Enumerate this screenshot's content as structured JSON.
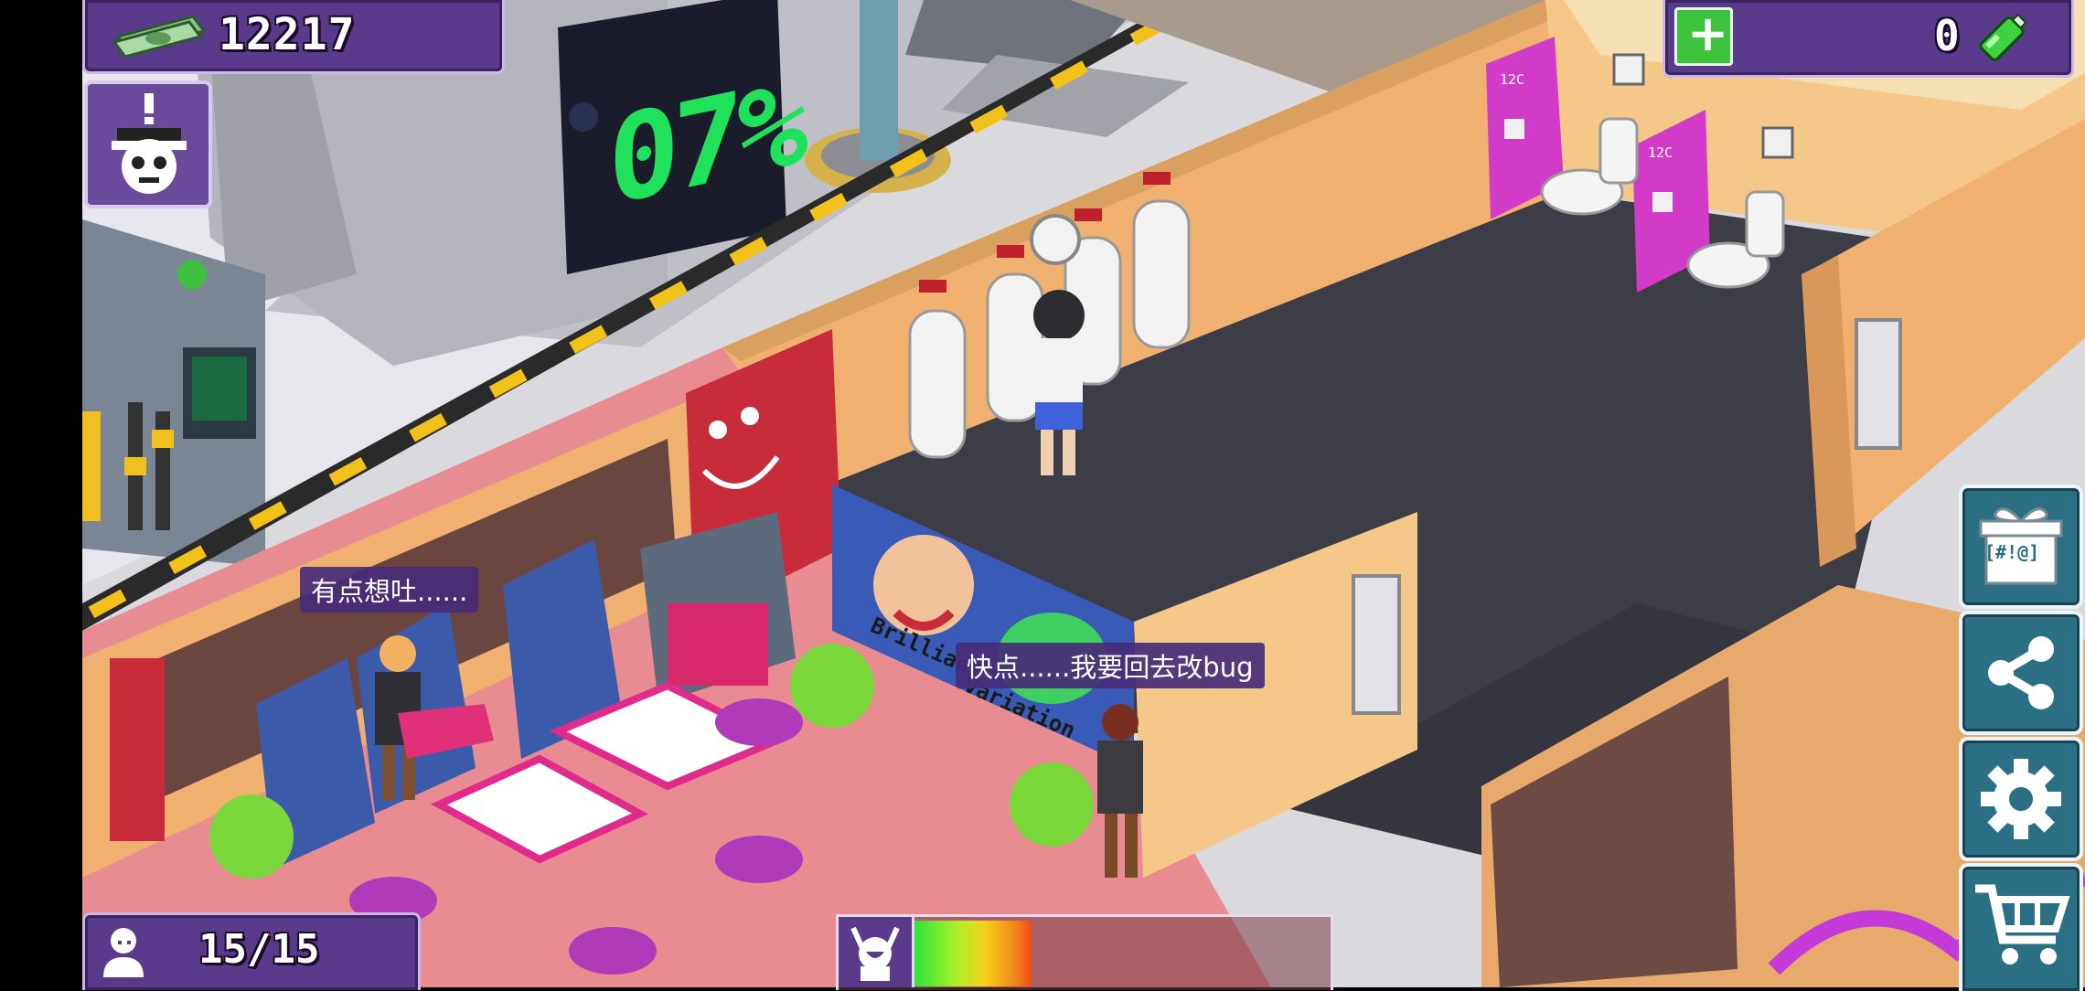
{
  "hud": {
    "money": "12217",
    "battery_count": "0",
    "visitors": "15/15",
    "machine_display": "07%"
  },
  "bubbles": {
    "customer_left": "有点想吐......",
    "customer_right": "快点......我要回去改bug"
  },
  "signs": {
    "billboard_line1": "Brilliant",
    "billboard_line2": "Variation",
    "toilet_sign": "12C",
    "gift_label": "[#!@]"
  },
  "colors": {
    "hud_purple": "#5a3a8a",
    "side_button": "#2b6f84",
    "floor_dark": "#3a3a44",
    "wall_orange": "#f0b070",
    "stall_pink": "#d23ac8"
  },
  "icons": [
    "cash-icon",
    "alert-robot-icon",
    "add-icon",
    "battery-icon",
    "person-icon",
    "happy-face-icon",
    "gift-icon",
    "share-icon",
    "gear-icon",
    "cart-icon"
  ]
}
